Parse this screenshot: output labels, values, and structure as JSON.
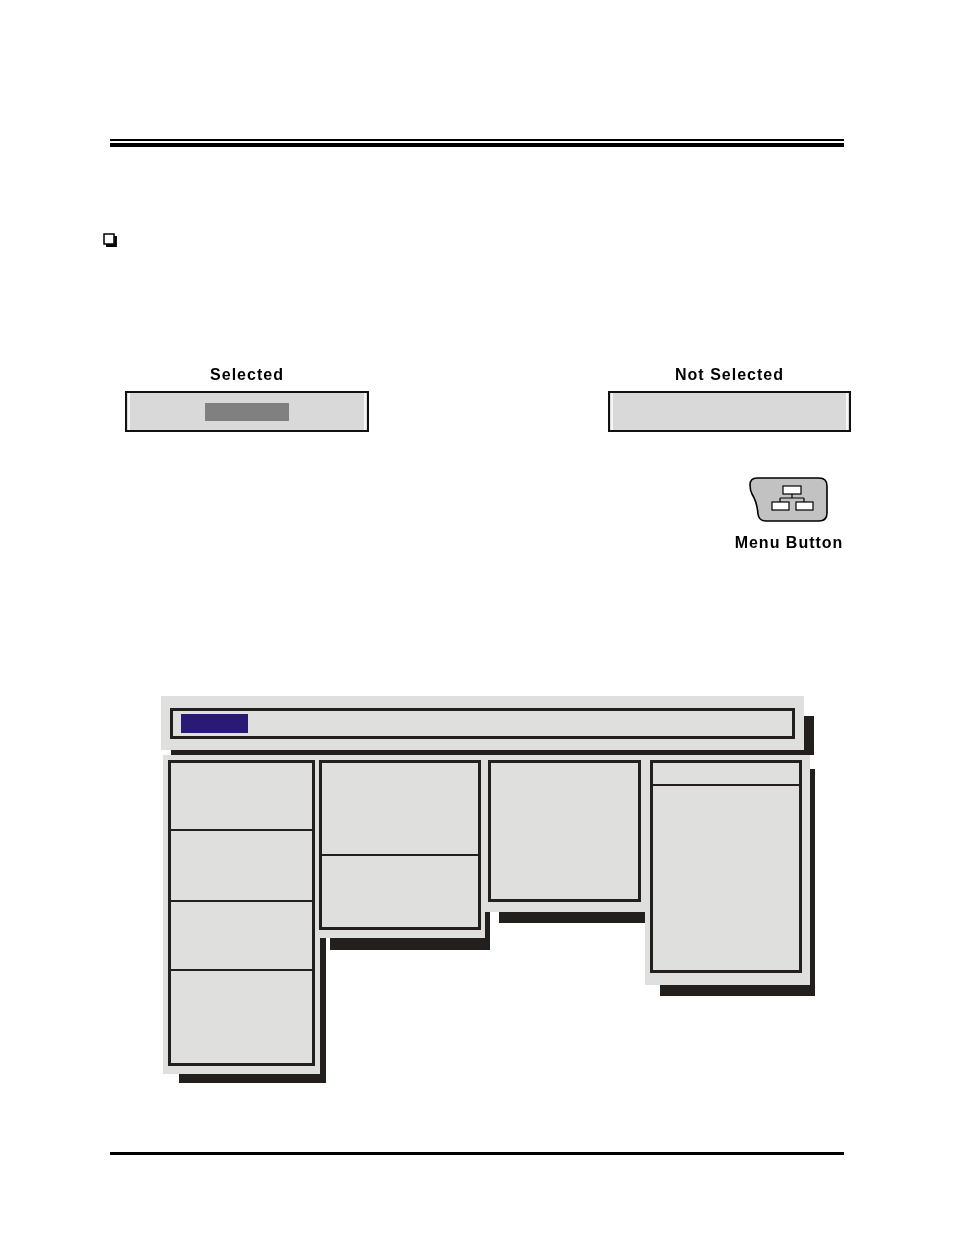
{
  "examples": [
    {
      "label": "Selected",
      "selected": true
    },
    {
      "label": "Not Selected",
      "selected": false
    }
  ],
  "menu_button": {
    "label": "Menu Button"
  },
  "menu_diagram": {
    "menu_bar": {
      "items": [
        {
          "selected": true
        }
      ]
    },
    "columns": [
      {
        "entries": [
          {
            "selected": false
          },
          {
            "selected": false
          },
          {
            "selected": false
          },
          {
            "selected": false
          }
        ]
      },
      {
        "entries": [
          {
            "selected": false
          },
          {
            "selected": false
          }
        ]
      },
      {
        "entries": [
          {
            "selected": false
          }
        ]
      },
      {
        "entries": [
          {
            "selected": false
          },
          {
            "selected": false
          }
        ]
      }
    ]
  }
}
